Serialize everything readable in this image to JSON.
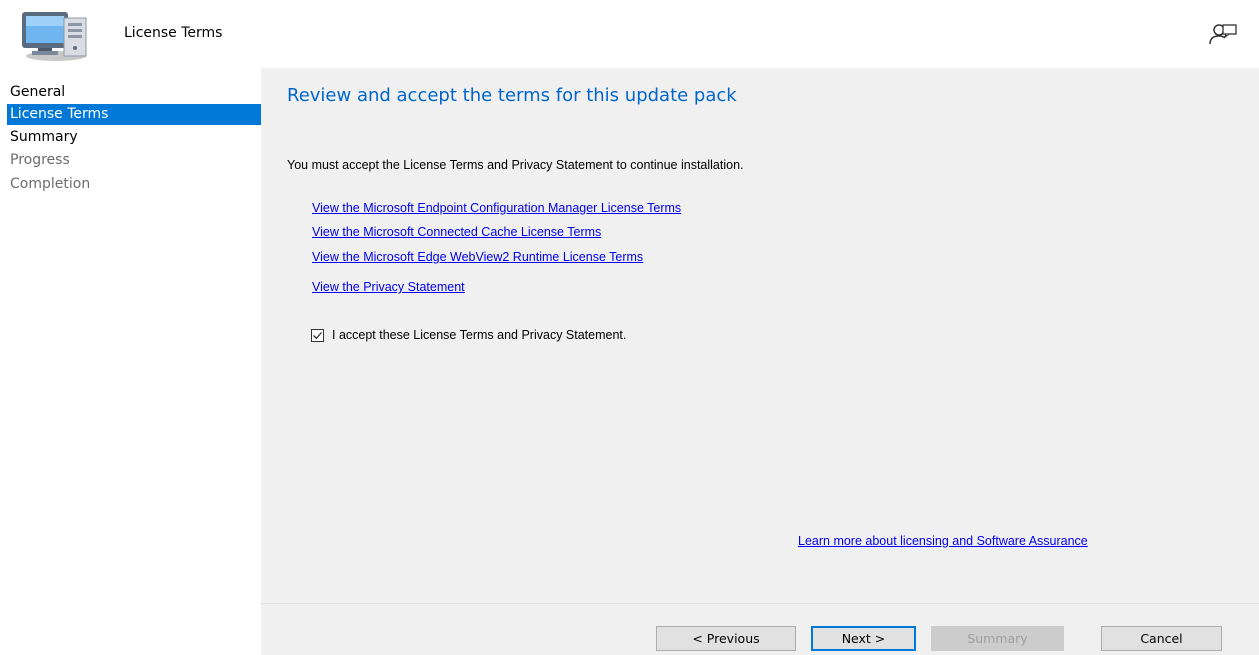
{
  "header": {
    "title": "License Terms"
  },
  "sidebar": {
    "items": [
      {
        "label": "General",
        "state": "normal"
      },
      {
        "label": "License Terms",
        "state": "selected"
      },
      {
        "label": "Summary",
        "state": "normal"
      },
      {
        "label": "Progress",
        "state": "disabled"
      },
      {
        "label": "Completion",
        "state": "disabled"
      }
    ]
  },
  "main": {
    "title": "Review and accept the terms for this update pack",
    "instruction": "You must accept the License Terms and Privacy Statement to continue installation.",
    "links": [
      "View the Microsoft Endpoint Configuration Manager License Terms",
      "View the Microsoft Connected Cache License Terms",
      "View the Microsoft Edge WebView2 Runtime License Terms",
      "View the Privacy Statement"
    ],
    "accept_checkbox": {
      "label": "I accept these License Terms and Privacy Statement.",
      "checked": true
    },
    "learn_more": "Learn more about licensing and Software Assurance"
  },
  "footer": {
    "previous_label": "< Previous",
    "next_label": "Next >",
    "summary_label": "Summary",
    "cancel_label": "Cancel"
  },
  "colors": {
    "accent": "#0078d7",
    "title_blue": "#0066cc",
    "link": "#0000ee",
    "panel_bg": "#f0f0f0"
  },
  "icons": {
    "header": "computer-icon",
    "feedback": "feedback-icon"
  }
}
